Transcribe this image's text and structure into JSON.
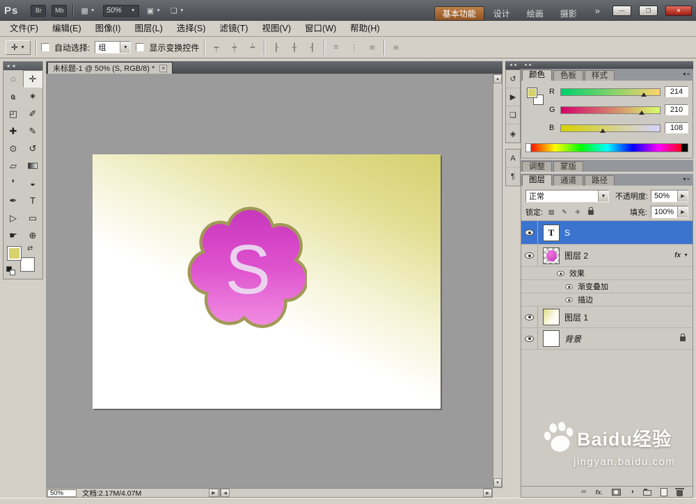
{
  "window": {
    "title_logo": "Ps",
    "buttons": {
      "bridge": "Br",
      "mobile": "Mb",
      "zoom": "50%"
    },
    "workspace_tabs": [
      {
        "label": "基本功能",
        "active": true
      },
      {
        "label": "设计",
        "active": false
      },
      {
        "label": "绘画",
        "active": false
      },
      {
        "label": "摄影",
        "active": false
      }
    ],
    "overflow": "»",
    "controls": {
      "minimize": "—",
      "restore": "❐",
      "close": "✕"
    }
  },
  "menu": {
    "items": [
      {
        "label": "文件(F)"
      },
      {
        "label": "编辑(E)"
      },
      {
        "label": "图像(I)"
      },
      {
        "label": "图层(L)"
      },
      {
        "label": "选择(S)"
      },
      {
        "label": "滤镜(T)"
      },
      {
        "label": "视图(V)"
      },
      {
        "label": "窗口(W)"
      },
      {
        "label": "帮助(H)"
      }
    ]
  },
  "options": {
    "tool_glyph": "✛",
    "auto_select_label": "自动选择:",
    "auto_select_value": "组",
    "show_transform_label": "显示变换控件",
    "align": [
      {
        "name": "align-top-edges",
        "glyph": "┯"
      },
      {
        "name": "align-vertical-centers",
        "glyph": "┿"
      },
      {
        "name": "align-bottom-edges",
        "glyph": "┷"
      },
      {
        "name": "align-left-edges",
        "glyph": "┠"
      },
      {
        "name": "align-horizontal-centers",
        "glyph": "╂"
      },
      {
        "name": "align-right-edges",
        "glyph": "┨"
      },
      {
        "name": "distribute-top-edges",
        "glyph": "≡"
      },
      {
        "name": "distribute-vertical-centers",
        "glyph": "⋮"
      },
      {
        "name": "distribute-left-edges",
        "glyph": "≋"
      }
    ],
    "auto_align_glyph": "≌"
  },
  "toolbox": {
    "tools": [
      {
        "name": "elliptical-marquee",
        "glyph": "◌"
      },
      {
        "name": "move",
        "glyph": "✛",
        "selected": true
      },
      {
        "name": "lasso",
        "glyph": "ҩ"
      },
      {
        "name": "magic-wand",
        "glyph": "✶"
      },
      {
        "name": "crop",
        "glyph": "◰"
      },
      {
        "name": "eyedropper",
        "glyph": "✐"
      },
      {
        "name": "spot-healing-brush",
        "glyph": "✚"
      },
      {
        "name": "brush",
        "glyph": "✎"
      },
      {
        "name": "clone-stamp",
        "glyph": "⊙"
      },
      {
        "name": "history-brush",
        "glyph": "↺"
      },
      {
        "name": "eraser",
        "glyph": "▱"
      },
      {
        "name": "gradient",
        "glyph": ""
      },
      {
        "name": "blur",
        "glyph": "❜"
      },
      {
        "name": "dodge",
        "glyph": "◒"
      },
      {
        "name": "pen",
        "glyph": "✒"
      },
      {
        "name": "horizontal-type",
        "glyph": "T"
      },
      {
        "name": "path-selection",
        "glyph": "▷"
      },
      {
        "name": "rectangle",
        "glyph": "▭"
      },
      {
        "name": "hand",
        "glyph": "☛"
      },
      {
        "name": "zoom",
        "glyph": "⊕"
      }
    ],
    "foreground_color": "#D6D26C",
    "background_color": "#FFFFFF"
  },
  "docwin": {
    "tab_title": "未标题-1 @ 50% (S, RGB/8) *",
    "letter": "S",
    "status_zoom": "50%",
    "status_info": "文档:2.17M/4.07M"
  },
  "strip": {
    "panels": [
      {
        "name": "history-panel",
        "glyph": "↺"
      },
      {
        "name": "actions-panel",
        "glyph": "▶"
      },
      {
        "name": "styles-panel",
        "glyph": "❏"
      },
      {
        "name": "info-panel",
        "glyph": "◈"
      }
    ],
    "character_panel": "A",
    "paragraph_panel": "¶"
  },
  "colors_panel": {
    "tabs": [
      {
        "label": "颜色",
        "active": true
      },
      {
        "label": "色板",
        "active": false
      },
      {
        "label": "样式",
        "active": false
      }
    ],
    "channels": [
      {
        "label": "R",
        "value": "214"
      },
      {
        "label": "G",
        "value": "210"
      },
      {
        "label": "B",
        "value": "108"
      }
    ]
  },
  "adjust_bar": {
    "tabs": [
      {
        "label": "调整"
      },
      {
        "label": "蒙版"
      }
    ]
  },
  "layers_panel": {
    "tabs": [
      {
        "label": "图层",
        "active": true
      },
      {
        "label": "通道",
        "active": false
      },
      {
        "label": "路径",
        "active": false
      }
    ],
    "blend_mode": "正常",
    "opacity_label": "不透明度:",
    "opacity_value": "50%",
    "lock_label": "锁定:",
    "fill_label": "填充:",
    "fill_value": "100%",
    "lock_icons": [
      {
        "name": "lock-transparent-pixels",
        "glyph": "▨"
      },
      {
        "name": "lock-image-pixels",
        "glyph": "✎"
      },
      {
        "name": "lock-position",
        "glyph": "✛"
      }
    ],
    "layer_s": "S",
    "thumb_t": "T",
    "layer_2": "图层 2",
    "fx_label": "fx",
    "effects_label": "效果",
    "effect_gradient": "渐变叠加",
    "effect_stroke": "描边",
    "layer_1": "图层 1",
    "layer_bg": "背景"
  },
  "icons": {
    "collapse": "◄◄",
    "panel_menu": "▼≡",
    "dropdown": "▼",
    "flyout": "▶",
    "close": "✕",
    "swap": "⇄",
    "grid": "▦",
    "arrange": "▣",
    "screen": "❏",
    "scroll_up": "▲",
    "scroll_down": "▼",
    "scroll_left": "◀",
    "scroll_right": "▶",
    "status_arrow": "▶",
    "link": "∞",
    "adjust_circle": "◑",
    "fx_footer": "fx."
  },
  "watermark": {
    "brand": "Baidu",
    "suffix": "经验",
    "url": "jingyan.baidu.com"
  },
  "theme": {
    "accent_orange": "#A96A33",
    "selection_blue": "#3B74CE",
    "foreground_swatch": "#D6D26C",
    "close_red": "#C23B2E",
    "canvas_gray": "#9B9B9B"
  }
}
